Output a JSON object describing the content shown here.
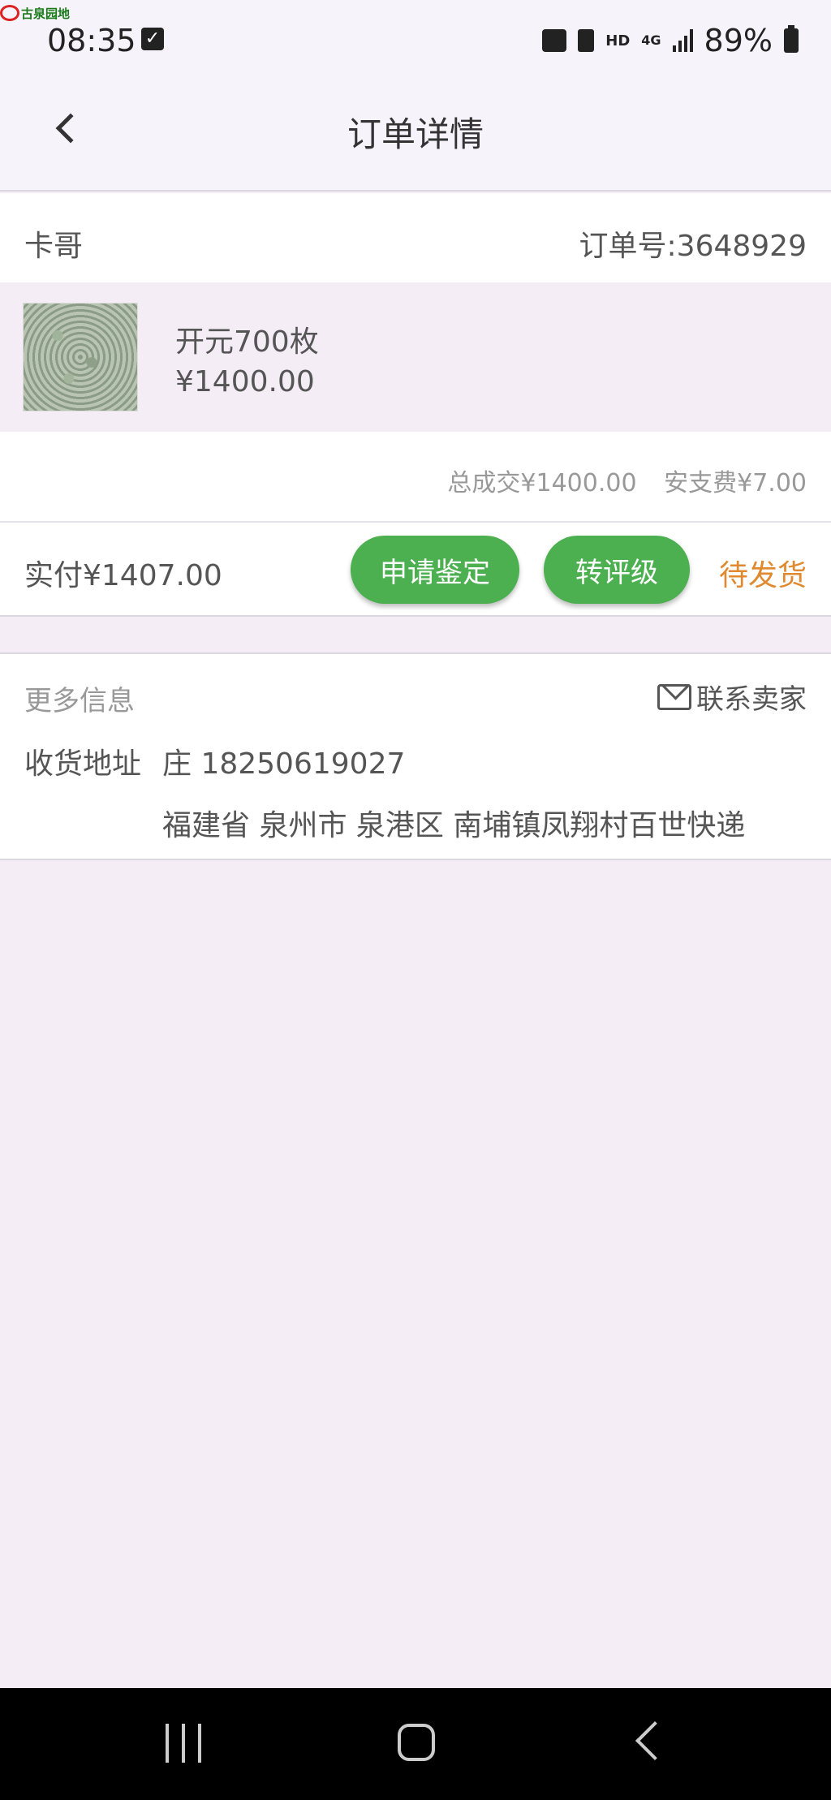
{
  "watermark": {
    "text": "古泉园地"
  },
  "status_bar": {
    "time": "08:35",
    "icons": [
      "check-icon",
      "message-icon",
      "battery-saver-icon",
      "signal-icon",
      "battery-icon"
    ],
    "hd": "HD",
    "network": "4G",
    "battery_pct": "89%"
  },
  "header": {
    "title": "订单详情"
  },
  "seller": {
    "name": "卡哥",
    "order_number": "订单号:3648929"
  },
  "product": {
    "name": "开元700枚",
    "price": "¥1400.00"
  },
  "totals": {
    "total": "总成交¥1400.00",
    "fee": "安支费¥7.00"
  },
  "payment": {
    "paid": "实付¥1407.00",
    "appraise_label": "申请鉴定",
    "grade_label": "转评级",
    "status": "待发货"
  },
  "more_info": {
    "title": "更多信息",
    "contact_label": "联系卖家",
    "address_label": "收货地址",
    "recipient": "庄 18250619027",
    "address": "福建省 泉州市 泉港区 南埔镇凤翔村百世快递"
  },
  "colors": {
    "accent_green": "#4caf50",
    "status_orange": "#e0892e",
    "page_bg": "#f4edf6"
  }
}
